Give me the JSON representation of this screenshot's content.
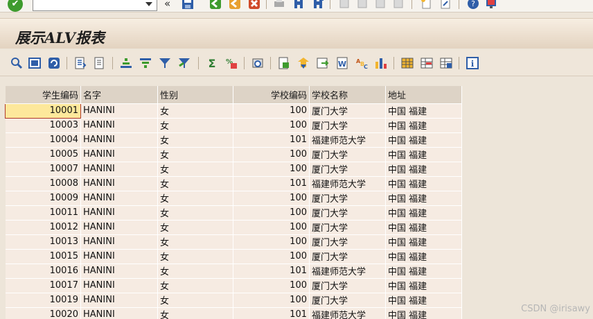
{
  "system_toolbar": {
    "command_field_value": "",
    "icons": [
      "enter-icon",
      "save-icon",
      "back-icon",
      "exit-icon",
      "cancel-icon",
      "print-icon",
      "find-icon",
      "find-next-icon",
      "first-page-icon",
      "previous-page-icon",
      "next-page-icon",
      "last-page-icon",
      "new-session-icon",
      "shortcut-icon",
      "help-icon",
      "layout-menu-icon"
    ]
  },
  "title": "展示ALV报表",
  "alv_toolbar": {
    "icons": [
      "details-icon",
      "select-all-icon",
      "refresh-icon",
      "check-icon",
      "edit-icon",
      "sort-ascending-icon",
      "sort-descending-icon",
      "filter-icon",
      "delete-filter-icon",
      "sum-icon",
      "subtotal-icon",
      "print-preview-icon",
      "export-icon",
      "send-icon",
      "local-file-icon",
      "word-icon",
      "abc-analysis-icon",
      "graphic-icon",
      "choose-layout-icon",
      "change-layout-icon",
      "save-layout-icon",
      "information-icon"
    ]
  },
  "table": {
    "columns": [
      "学生编码",
      "名字",
      "性别",
      "学校编码",
      "学校名称",
      "地址"
    ],
    "rows": [
      [
        "10001",
        "HANINI",
        "女",
        "100",
        "厦门大学",
        "中国 福建"
      ],
      [
        "10003",
        "HANINI",
        "女",
        "100",
        "厦门大学",
        "中国 福建"
      ],
      [
        "10004",
        "HANINI",
        "女",
        "101",
        "福建师范大学",
        "中国 福建"
      ],
      [
        "10005",
        "HANINI",
        "女",
        "100",
        "厦门大学",
        "中国 福建"
      ],
      [
        "10007",
        "HANINI",
        "女",
        "100",
        "厦门大学",
        "中国 福建"
      ],
      [
        "10008",
        "HANINI",
        "女",
        "101",
        "福建师范大学",
        "中国 福建"
      ],
      [
        "10009",
        "HANINI",
        "女",
        "100",
        "厦门大学",
        "中国 福建"
      ],
      [
        "10011",
        "HANINI",
        "女",
        "100",
        "厦门大学",
        "中国 福建"
      ],
      [
        "10012",
        "HANINI",
        "女",
        "100",
        "厦门大学",
        "中国 福建"
      ],
      [
        "10013",
        "HANINI",
        "女",
        "100",
        "厦门大学",
        "中国 福建"
      ],
      [
        "10015",
        "HANINI",
        "女",
        "100",
        "厦门大学",
        "中国 福建"
      ],
      [
        "10016",
        "HANINI",
        "女",
        "101",
        "福建师范大学",
        "中国 福建"
      ],
      [
        "10017",
        "HANINI",
        "女",
        "100",
        "厦门大学",
        "中国 福建"
      ],
      [
        "10019",
        "HANINI",
        "女",
        "100",
        "厦门大学",
        "中国 福建"
      ],
      [
        "10020",
        "HANINI",
        "女",
        "101",
        "福建师范大学",
        "中国 福建"
      ]
    ],
    "selected_cell": {
      "row": 0,
      "col": 0
    }
  },
  "watermark": "CSDN @irisawy"
}
